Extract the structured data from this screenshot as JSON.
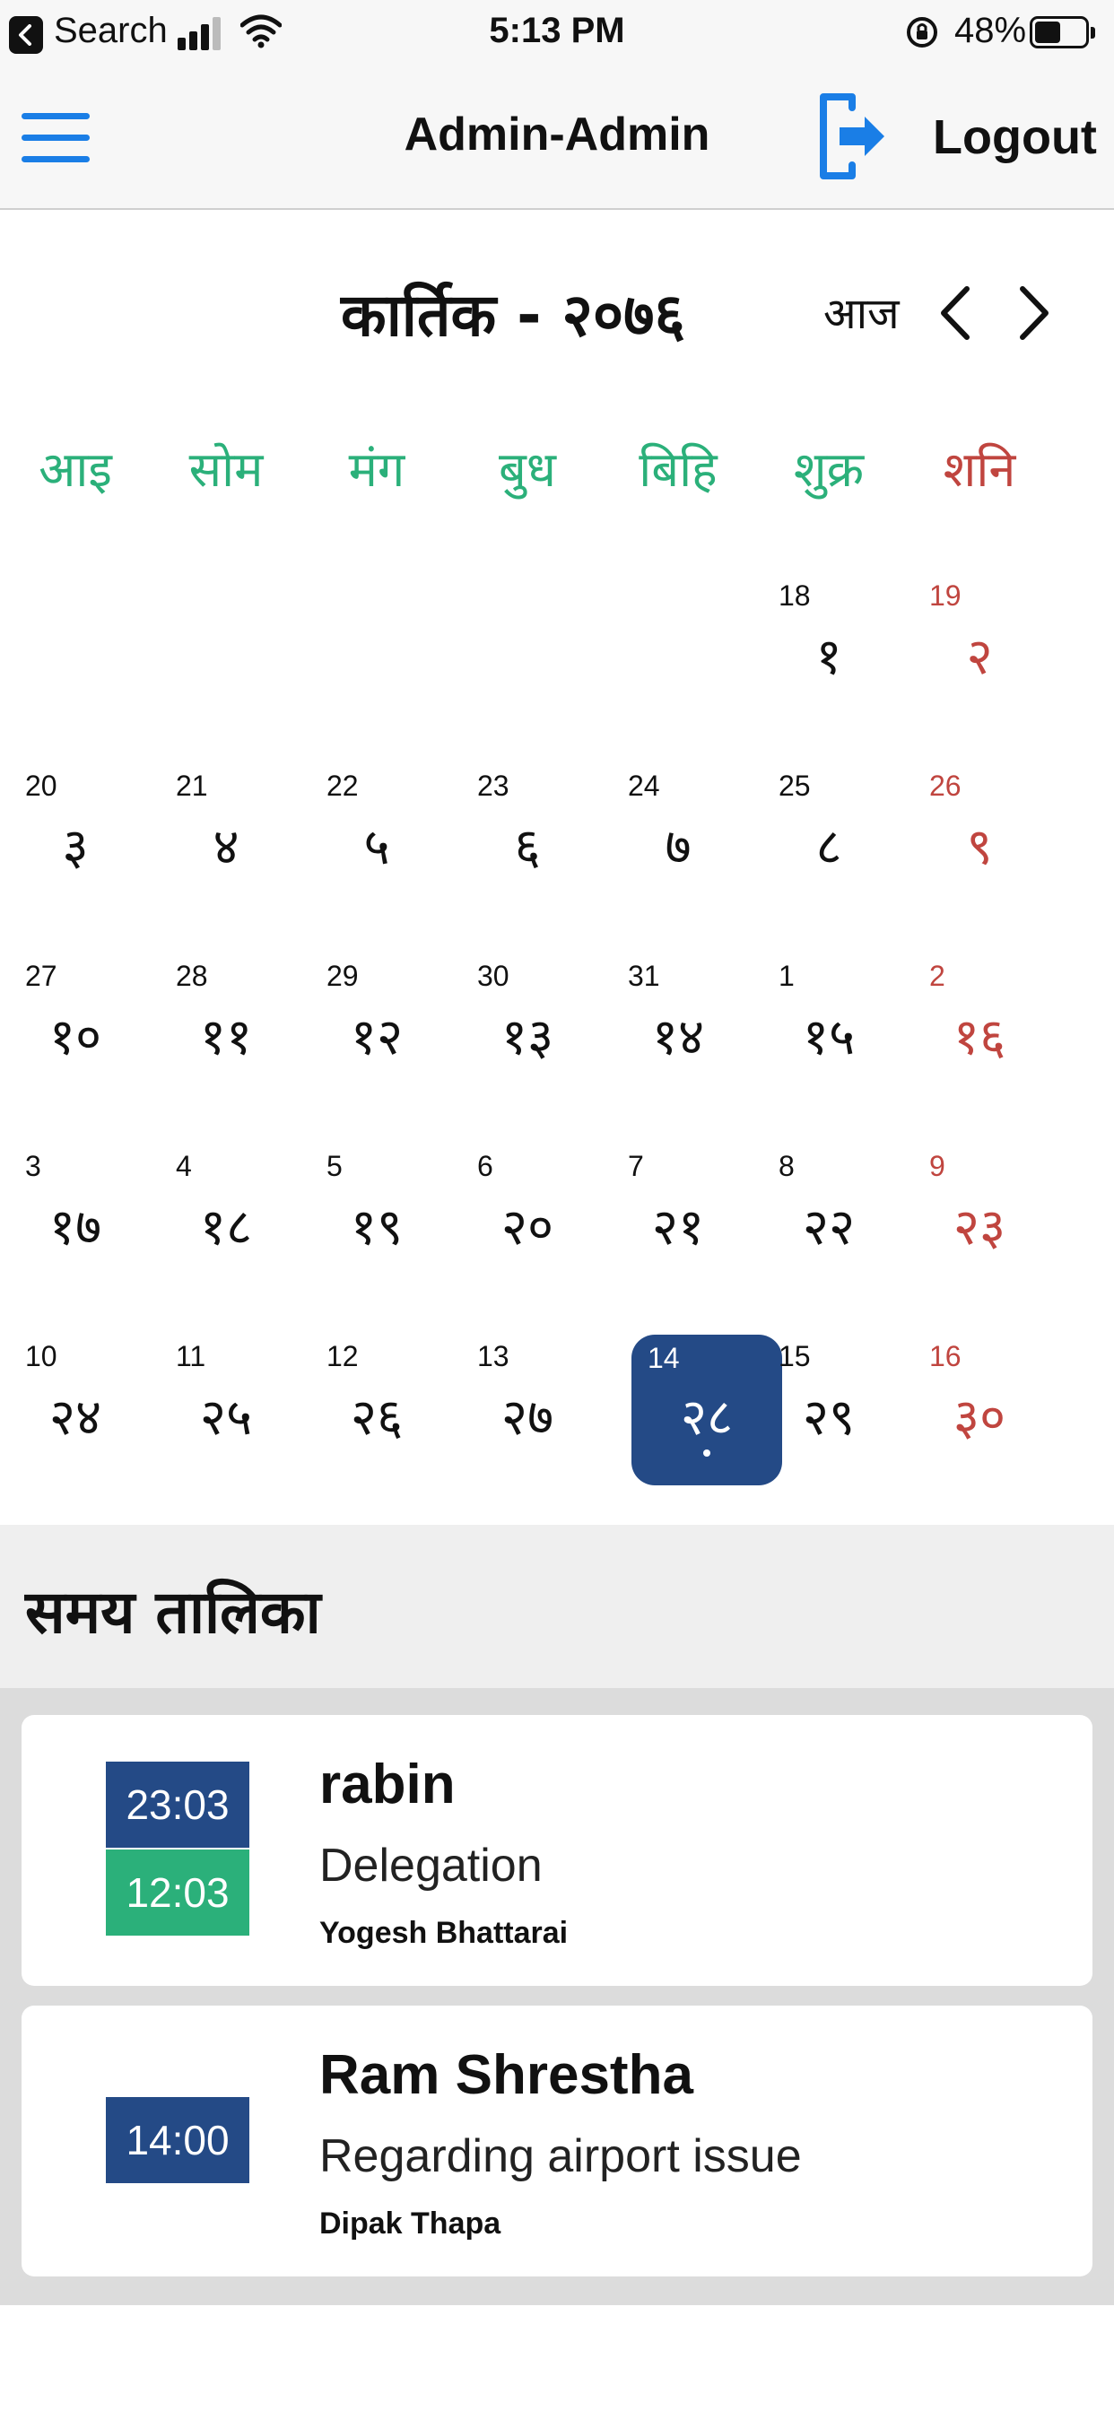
{
  "status_bar": {
    "back_label": "Search",
    "time": "5:13 PM",
    "battery": "48%",
    "battery_level": 0.48
  },
  "nav": {
    "title": "Admin-Admin",
    "logout_label": "Logout"
  },
  "calendar": {
    "month_title": "कार्तिक - २०७६",
    "today_label": "आज",
    "weekdays": [
      "आइ",
      "सोम",
      "मंग",
      "बुध",
      "बिहि",
      "शुक्र",
      "शनि"
    ],
    "weeks": [
      [
        null,
        null,
        null,
        null,
        null,
        {
          "ad": "18",
          "bs": "१"
        },
        {
          "ad": "19",
          "bs": "२"
        }
      ],
      [
        {
          "ad": "20",
          "bs": "३"
        },
        {
          "ad": "21",
          "bs": "४"
        },
        {
          "ad": "22",
          "bs": "५"
        },
        {
          "ad": "23",
          "bs": "६"
        },
        {
          "ad": "24",
          "bs": "७"
        },
        {
          "ad": "25",
          "bs": "८"
        },
        {
          "ad": "26",
          "bs": "९"
        }
      ],
      [
        {
          "ad": "27",
          "bs": "१०"
        },
        {
          "ad": "28",
          "bs": "११"
        },
        {
          "ad": "29",
          "bs": "१२"
        },
        {
          "ad": "30",
          "bs": "१३"
        },
        {
          "ad": "31",
          "bs": "१४"
        },
        {
          "ad": "1",
          "bs": "१५"
        },
        {
          "ad": "2",
          "bs": "१६"
        }
      ],
      [
        {
          "ad": "3",
          "bs": "१७"
        },
        {
          "ad": "4",
          "bs": "१८"
        },
        {
          "ad": "5",
          "bs": "१९"
        },
        {
          "ad": "6",
          "bs": "२०"
        },
        {
          "ad": "7",
          "bs": "२१"
        },
        {
          "ad": "8",
          "bs": "२२"
        },
        {
          "ad": "9",
          "bs": "२३"
        }
      ],
      [
        {
          "ad": "10",
          "bs": "२४"
        },
        {
          "ad": "11",
          "bs": "२५"
        },
        {
          "ad": "12",
          "bs": "२६"
        },
        {
          "ad": "13",
          "bs": "२७"
        },
        {
          "ad": "14",
          "bs": "२८",
          "selected": true
        },
        {
          "ad": "15",
          "bs": "२९"
        },
        {
          "ad": "16",
          "bs": "३०"
        }
      ]
    ]
  },
  "schedule": {
    "title": "समय तालिका",
    "items": [
      {
        "start": "23:03",
        "end": "12:03",
        "person": "rabin",
        "subject": "Delegation",
        "by": "Yogesh Bhattarai"
      },
      {
        "start": "14:00",
        "person": "Ram Shrestha",
        "subject": "Regarding airport issue",
        "by": "Dipak Thapa"
      }
    ]
  },
  "colors": {
    "accent_blue": "#1a7ee6",
    "navy": "#244a86",
    "green": "#2bb07a",
    "saturday_red": "#c0453f"
  }
}
